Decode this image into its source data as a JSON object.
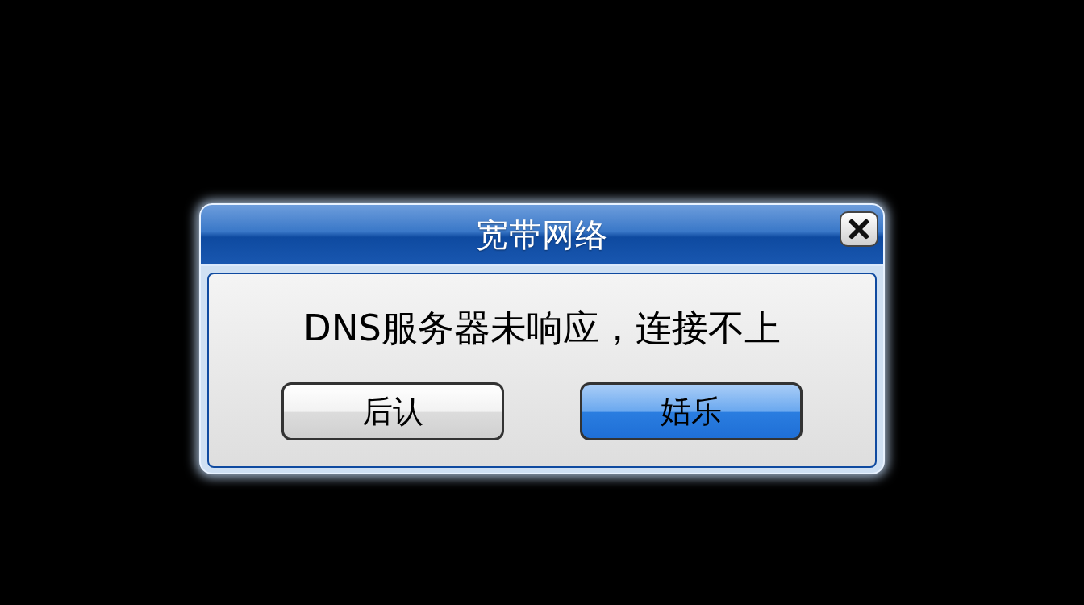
{
  "dialog": {
    "title": "宽带网络",
    "message": "DNS服务器未响应，连接不上",
    "buttons": [
      {
        "label": "后认",
        "selected": false
      },
      {
        "label": "姡乐",
        "selected": true
      }
    ]
  }
}
